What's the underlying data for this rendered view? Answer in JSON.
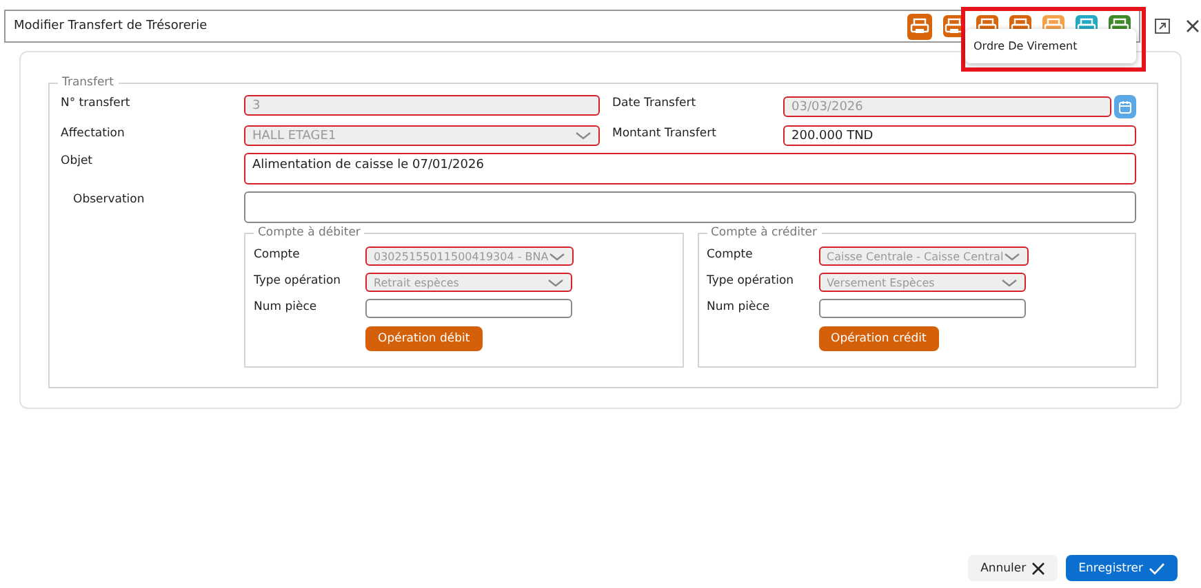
{
  "window": {
    "title": "Modifier Transfert de Trésorerie"
  },
  "toolbar": {
    "icons": [
      {
        "kind": "print",
        "color": "#d8640c"
      },
      {
        "kind": "print",
        "color": "#d8640c"
      },
      {
        "kind": "print",
        "color": "#d8640c"
      },
      {
        "kind": "print",
        "color": "#d8640c"
      },
      {
        "kind": "print",
        "color": "#f4a14a"
      },
      {
        "kind": "print",
        "color": "#22a9c4"
      },
      {
        "kind": "print",
        "color": "#3f8a2a"
      }
    ]
  },
  "menu": {
    "items": [
      "Ordre De Virement"
    ]
  },
  "form": {
    "title": "Transfert",
    "fields": [
      {
        "label": "N° transfert",
        "kind": "text",
        "value": "3",
        "disabled": true,
        "invalid": true
      },
      {
        "label": "Date Transfert",
        "kind": "date",
        "value": "03/03/2026",
        "disabled": true,
        "invalid": true
      },
      {
        "label": "Affectation",
        "kind": "select",
        "value": "HALL ETAGE1",
        "disabled": true,
        "invalid": true
      },
      {
        "label": "Montant Transfert",
        "kind": "text",
        "value": "200.000 TND",
        "disabled": false,
        "invalid": true
      },
      {
        "label": "Objet",
        "kind": "textarea",
        "value": "Alimentation de caisse le 07/01/2026",
        "disabled": false,
        "invalid": true
      },
      {
        "label": "Observation",
        "kind": "textarea",
        "disabled": false,
        "invalid": false
      }
    ],
    "accounts": [
      {
        "title": "Compte à débiter",
        "button": "Opération débit",
        "fields": [
          {
            "label": "Compte",
            "kind": "select",
            "value": "03025155011500419304 - BNA",
            "disabled": true,
            "invalid": true
          },
          {
            "label": "Type opération",
            "kind": "select",
            "value": "Retrait espèces",
            "disabled": true,
            "invalid": true
          },
          {
            "label": "Num pièce",
            "kind": "text",
            "disabled": false,
            "invalid": false
          }
        ]
      },
      {
        "title": "Compte à créditer",
        "button": "Opération crédit",
        "fields": [
          {
            "label": "Compte",
            "kind": "select",
            "value": "Caisse Centrale - Caisse Central",
            "disabled": true,
            "invalid": true
          },
          {
            "label": "Type opération",
            "kind": "select",
            "value": "Versement Espèces",
            "disabled": true,
            "invalid": true
          },
          {
            "label": "Num pièce",
            "kind": "text",
            "disabled": false,
            "invalid": false
          }
        ]
      }
    ]
  },
  "footer": {
    "buttons": [
      {
        "label": "Annuler",
        "kind": "cancel"
      },
      {
        "label": "Enregistrer",
        "kind": "save"
      }
    ]
  }
}
